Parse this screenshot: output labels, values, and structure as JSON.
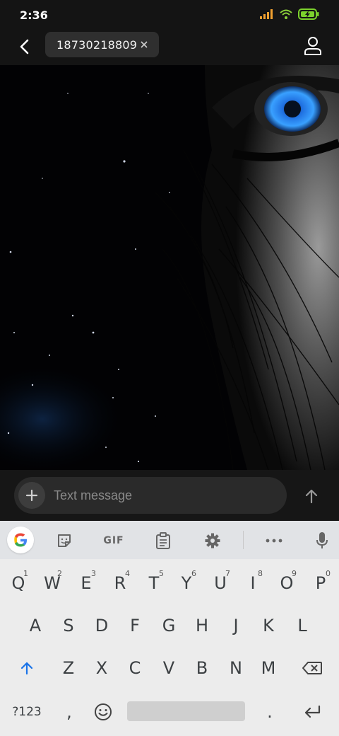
{
  "status_bar": {
    "time": "2:36"
  },
  "header": {
    "recipient": "18730218809"
  },
  "compose": {
    "placeholder": "Text message"
  },
  "keyboard": {
    "toolbar": {
      "gif_label": "GIF"
    },
    "row1": [
      {
        "key": "Q",
        "hint": "1"
      },
      {
        "key": "W",
        "hint": "2"
      },
      {
        "key": "E",
        "hint": "3"
      },
      {
        "key": "R",
        "hint": "4"
      },
      {
        "key": "T",
        "hint": "5"
      },
      {
        "key": "Y",
        "hint": "6"
      },
      {
        "key": "U",
        "hint": "7"
      },
      {
        "key": "I",
        "hint": "8"
      },
      {
        "key": "O",
        "hint": "9"
      },
      {
        "key": "P",
        "hint": "0"
      }
    ],
    "row2": [
      "A",
      "S",
      "D",
      "F",
      "G",
      "H",
      "J",
      "K",
      "L"
    ],
    "row3": [
      "Z",
      "X",
      "C",
      "V",
      "B",
      "N",
      "M"
    ],
    "bottom": {
      "symbols_label": "?123",
      "comma": ",",
      "period": "."
    }
  },
  "colors": {
    "accent": "#1a73e8",
    "eye_blue": "#2f8cff",
    "header_bg": "#141414"
  }
}
